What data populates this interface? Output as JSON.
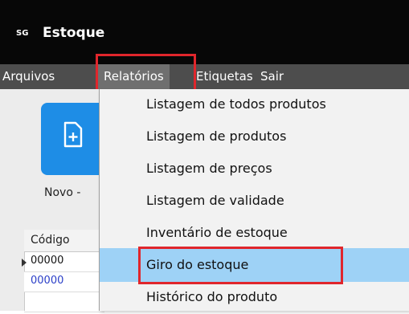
{
  "window": {
    "badge": "SG",
    "title": "Estoque"
  },
  "menubar": {
    "items": [
      {
        "label": "Arquivos"
      },
      {
        "label": "Relatórios"
      },
      {
        "label": "Etiquetas"
      },
      {
        "label": "Sair"
      }
    ]
  },
  "toolbar": {
    "new_label": "Novo -",
    "new_icon": "document-plus-icon"
  },
  "grid": {
    "column_header": "Código",
    "rows": [
      {
        "code": "00000"
      },
      {
        "code": "00000"
      }
    ]
  },
  "relatorios_menu": {
    "items": [
      {
        "label": "Listagem de todos produtos"
      },
      {
        "label": "Listagem de produtos"
      },
      {
        "label": "Listagem de preços"
      },
      {
        "label": "Listagem de validade"
      },
      {
        "label": "Inventário de estoque"
      },
      {
        "label": "Giro do estoque"
      },
      {
        "label": "Histórico do produto"
      }
    ]
  },
  "colors": {
    "highlight_border": "#e0262c",
    "selected_item": "#9ed2f6",
    "button_blue": "#1e8de6",
    "menubar": "#4d4d4d",
    "titlebar": "#070707"
  }
}
